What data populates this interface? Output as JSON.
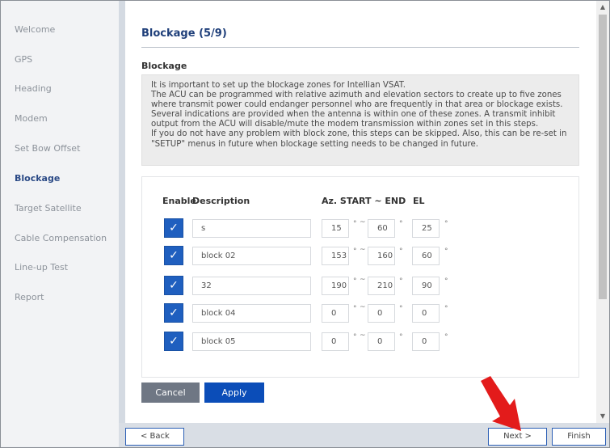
{
  "sidebar": {
    "items": [
      {
        "label": "Welcome",
        "active": false
      },
      {
        "label": "GPS",
        "active": false
      },
      {
        "label": "Heading",
        "active": false
      },
      {
        "label": "Modem",
        "active": false
      },
      {
        "label": "Set Bow Offset",
        "active": false
      },
      {
        "label": "Blockage",
        "active": true
      },
      {
        "label": "Target Satellite",
        "active": false
      },
      {
        "label": "Cable Compensation",
        "active": false
      },
      {
        "label": "Line-up Test",
        "active": false
      },
      {
        "label": "Report",
        "active": false
      }
    ]
  },
  "main": {
    "title": "Blockage (5/9)",
    "section_heading": "Blockage",
    "info_paragraphs": [
      "It is important to set up the blockage zones for Intellian VSAT.",
      "The ACU can be programmed with relative azimuth and elevation sectors to create up to five zones where transmit power could endanger personnel who are frequently in that area or blockage exists. Several indications are provided when the antenna is within one of these zones. A transmit inhibit output from the ACU will disable/mute the modem transmission within zones set in this steps.",
      "If you do not have any problem with block zone, this steps can be skipped. Also, this can be re-set in \"SETUP\" menus in future when blockage setting needs to be changed in future."
    ],
    "table": {
      "headers": {
        "enable": "Enable",
        "description": "Description",
        "az": "Az. START ~ END",
        "el": "EL"
      },
      "degree_symbol": "°",
      "tilde": "~",
      "rows": [
        {
          "enabled": true,
          "description": "s",
          "az_start": "15",
          "az_end": "60",
          "el": "25"
        },
        {
          "enabled": true,
          "description": "block 02",
          "az_start": "153",
          "az_end": "160",
          "el": "60"
        },
        {
          "enabled": true,
          "description": "32",
          "az_start": "190",
          "az_end": "210",
          "el": "90"
        },
        {
          "enabled": true,
          "description": "block 04",
          "az_start": "0",
          "az_end": "0",
          "el": "0"
        },
        {
          "enabled": true,
          "description": "block 05",
          "az_start": "0",
          "az_end": "0",
          "el": "0"
        }
      ]
    },
    "cancel_label": "Cancel",
    "apply_label": "Apply"
  },
  "footer": {
    "back_label": "< Back",
    "next_label": "Next >",
    "finish_label": "Finish"
  },
  "colors": {
    "accent": "#0b4db8",
    "title": "#1f3f7a",
    "annotation_arrow": "#e31b1b"
  }
}
